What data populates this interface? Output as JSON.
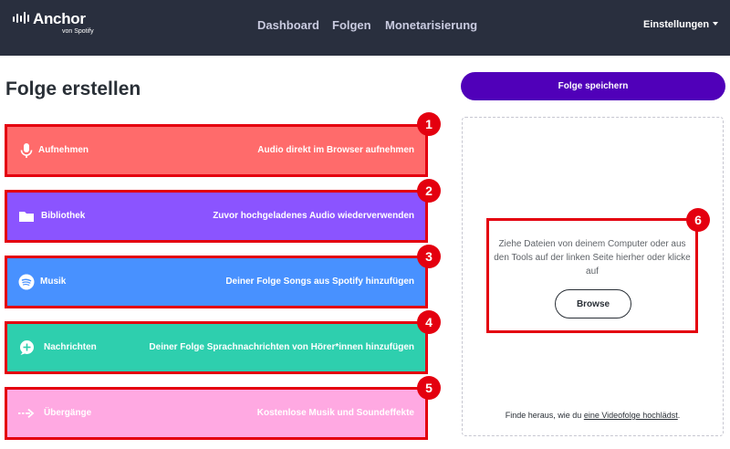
{
  "header": {
    "logo": {
      "name": "Anchor",
      "sub": "von Spotify"
    },
    "nav": [
      {
        "label": "Dashboard"
      },
      {
        "label": "Folgen"
      },
      {
        "label": "Monetarisierung"
      }
    ],
    "settings_label": "Einstellungen",
    "background_color": "#292f3e"
  },
  "page_title": "Folge erstellen",
  "tools": [
    {
      "number": "1",
      "label": "Aufnehmen",
      "description": "Audio direkt im Browser aufnehmen",
      "color": "#ff6b6b",
      "icon": "microphone-icon"
    },
    {
      "number": "2",
      "label": "Bibliothek",
      "description": "Zuvor hochgeladenes Audio wiederverwenden",
      "color": "#8b54ff",
      "icon": "folder-icon"
    },
    {
      "number": "3",
      "label": "Musik",
      "description": "Deiner Folge Songs aus Spotify hinzufügen",
      "color": "#4891ff",
      "icon": "spotify-icon"
    },
    {
      "number": "4",
      "label": "Nachrichten",
      "description": "Deiner Folge Sprachnachrichten von Hörer*innen hinzufügen",
      "color": "#2ecfae",
      "icon": "message-plus-icon"
    },
    {
      "number": "5",
      "label": "Übergänge",
      "description": "Kostenlose Musik und Soundeffekte",
      "color": "#ffa9e2",
      "icon": "arrow-right-icon"
    }
  ],
  "save_button": {
    "label": "Folge speichern",
    "color": "#5000b9"
  },
  "dropzone": {
    "number": "6",
    "text": "Ziehe Dateien von deinem Computer oder aus den Tools auf der linken Seite hierher oder klicke auf",
    "browse_label": "Browse",
    "video_hint_prefix": "Finde heraus, wie du ",
    "video_hint_link": "eine Videofolge hochlädst",
    "video_hint_suffix": "."
  },
  "annotation_color": "#e4000f"
}
